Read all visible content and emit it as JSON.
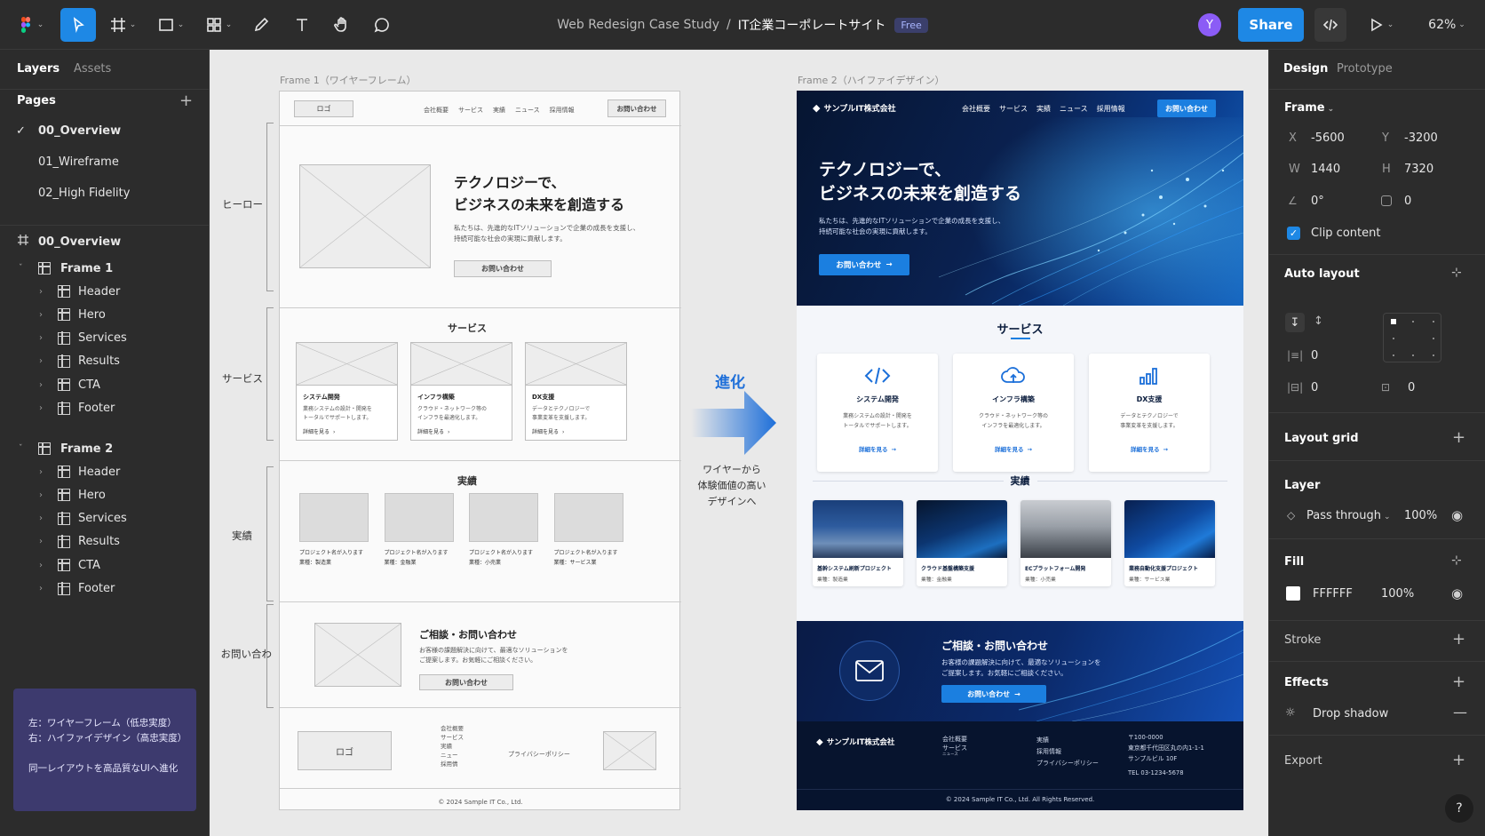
{
  "topbar": {
    "breadcrumb_project": "Web Redesign Case Study",
    "breadcrumb_sep": "/",
    "breadcrumb_file": "IT企業コーポレートサイト",
    "plan_badge": "Free",
    "avatar_initial": "Y",
    "share_label": "Share",
    "zoom": "62%",
    "accent": "#1e88e5"
  },
  "left": {
    "tabs": [
      "Layers",
      "Assets"
    ],
    "pages_title": "Pages",
    "pages": [
      "00_Overview",
      "01_Wireframe",
      "02_High Fidelity"
    ],
    "current_page": "00_Overview",
    "layers_root": "00_Overview",
    "frame1": {
      "name": "Frame 1",
      "children": [
        "Header",
        "Hero",
        "Services",
        "Results",
        "CTA",
        "Footer"
      ]
    },
    "frame2": {
      "name": "Frame 2",
      "children": [
        "Header",
        "Hero",
        "Services",
        "Results",
        "CTA",
        "Footer"
      ]
    },
    "note": {
      "line1": "左：ワイヤーフレーム（低忠実度）",
      "line2": "右：ハイファイデザイン（高忠実度）",
      "line3": "同一レイアウトを高品質なUIへ進化"
    }
  },
  "right": {
    "tabs": [
      "Design",
      "Prototype"
    ],
    "frame_label": "Frame",
    "x_label": "X",
    "x": "-5600",
    "y_label": "Y",
    "y": "-3200",
    "w_label": "W",
    "w": "1440",
    "h_label": "H",
    "h": "7320",
    "rotation": "0°",
    "radius": "0",
    "clip_label": "Clip content",
    "autolayout_title": "Auto layout",
    "al_gap_h": "0",
    "al_pad_h": "0",
    "al_pad_v": "0",
    "layout_grid_title": "Layout grid",
    "layer_title": "Layer",
    "blend": "Pass through",
    "layer_opacity": "100%",
    "fill_title": "Fill",
    "fill_hex": "FFFFFF",
    "fill_opacity": "100%",
    "stroke_title": "Stroke",
    "effects_title": "Effects",
    "effect_item": "Drop shadow",
    "export_title": "Export",
    "help": "?"
  },
  "canvas": {
    "frame1_label": "Frame 1（ワイヤーフレーム）",
    "frame2_label": "Frame 2（ハイファイデザイン）",
    "evolution_title": "進化",
    "evolution_lines": [
      "ワイヤーから",
      "体験価値の高い",
      "デザインへ"
    ],
    "brackets": [
      "ヒーロー",
      "サービス",
      "実績",
      "お問い合わ"
    ]
  },
  "site": {
    "nav": [
      "会社概要",
      "サービス",
      "実績",
      "ニュース",
      "採用情報"
    ],
    "contact_btn": "お問い合わせ",
    "logo_wire": "ロゴ",
    "company": "サンプルIT株式会社",
    "hero_title1": "テクノロジーで、",
    "hero_title2": "ビジネスの未来を創造する",
    "hero_desc1": "私たちは、先進的なITソリューションで企業の成長を支援し、",
    "hero_desc2": "持続可能な社会の実現に貢献します。",
    "hero_btn": "お問い合わせ",
    "services_title": "サービス",
    "services": [
      {
        "name": "システム開発",
        "desc1": "業務システムの設計・開発を",
        "desc2": "トータルでサポートします。",
        "link": "詳細を見る"
      },
      {
        "name": "インフラ構築",
        "desc1": "クラウド・ネットワーク等の",
        "desc2": "インフラを最適化します。",
        "link": "詳細を見る"
      },
      {
        "name": "DX支援",
        "desc1": "データとテクノロジーで",
        "desc2": "事業変革を支援します。",
        "link": "詳細を見る"
      }
    ],
    "results_title": "実績",
    "results_wire": [
      {
        "name": "プロジェクト名が入ります",
        "ind": "業種：製造業"
      },
      {
        "name": "プロジェクト名が入ります",
        "ind": "業種：金融業"
      },
      {
        "name": "プロジェクト名が入ります",
        "ind": "業種：小売業"
      },
      {
        "name": "プロジェクト名が入ります",
        "ind": "業種：サービス業"
      }
    ],
    "results_hifi": [
      {
        "name": "基幹システム刷新プロジェクト",
        "ind": "業種：製造業"
      },
      {
        "name": "クラウド基盤構築支援",
        "ind": "業種：金融業"
      },
      {
        "name": "ECプラットフォーム開発",
        "ind": "業種：小売業"
      },
      {
        "name": "業務自動化支援プロジェクト",
        "ind": "業種：サービス業"
      }
    ],
    "cta_title": "ご相談・お問い合わせ",
    "cta_desc1": "お客様の課題解決に向けて、最適なソリューションを",
    "cta_desc2": "ご提案します。お気軽にご相談ください。",
    "cta_btn": "お問い合わせ",
    "footer_links_wire": [
      "会社概要",
      "サービス",
      "実績",
      "ニュー",
      "採用情"
    ],
    "footer_col1": [
      "会社概要",
      "サービス"
    ],
    "footer_col1_small": "ニュース",
    "footer_col2": [
      "実績",
      "採用情報",
      "プライバシーポリシー"
    ],
    "footer_privacy_wire": "プライバシーポリシー",
    "address": [
      "〒100-0000",
      "東京都千代田区丸の内1-1-1",
      "サンプルビル 10F",
      "TEL 03-1234-5678"
    ],
    "copyright_wire": "© 2024 Sample IT Co., Ltd.",
    "copyright_hifi": "© 2024 Sample IT Co., Ltd. All Rights Reserved."
  }
}
